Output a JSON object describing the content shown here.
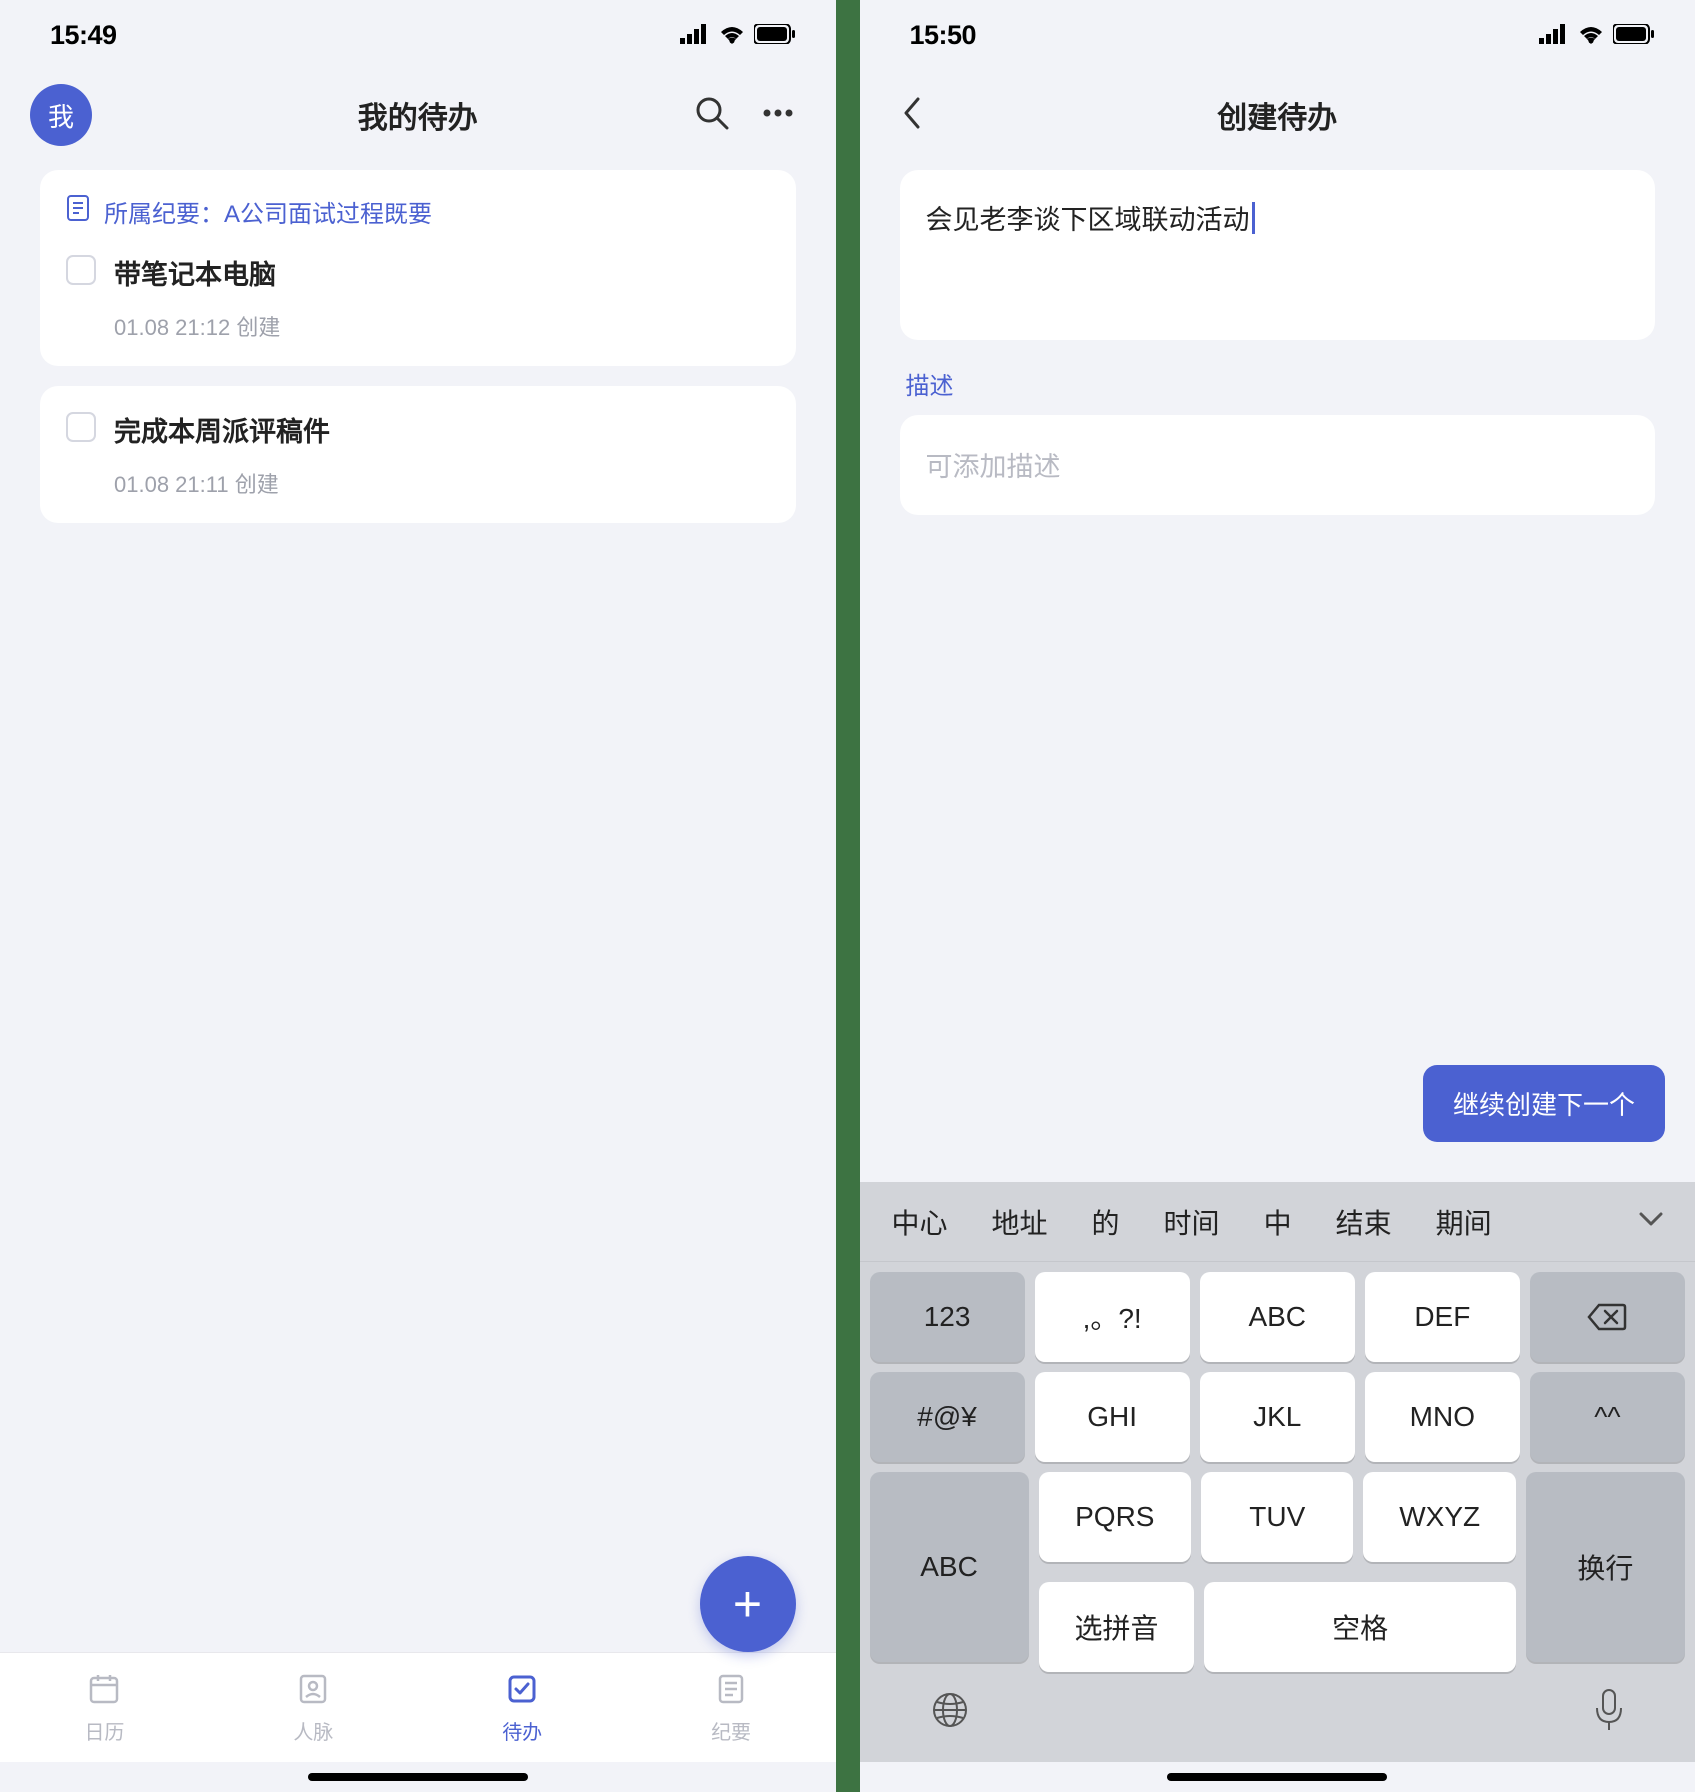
{
  "left": {
    "status_time": "15:49",
    "header": {
      "avatar_text": "我",
      "title": "我的待办"
    },
    "link_prefix": "所属纪要：",
    "link_text": "A公司面试过程既要",
    "todos": [
      {
        "text": "带笔记本电脑",
        "meta": "01.08 21:12 创建"
      },
      {
        "text": "完成本周派评稿件",
        "meta": "01.08 21:11 创建"
      }
    ],
    "nav": {
      "calendar": "日历",
      "contacts": "人脉",
      "todo": "待办",
      "notes": "纪要"
    }
  },
  "right": {
    "status_time": "15:50",
    "header": {
      "title": "创建待办"
    },
    "title_value": "会见老李谈下区域联动活动",
    "desc_label": "描述",
    "desc_placeholder": "可添加描述",
    "continue_label": "继续创建下一个",
    "suggestions": [
      "中心",
      "地址",
      "的",
      "时间",
      "中",
      "结束",
      "期间"
    ],
    "keys": {
      "num": "123",
      "punct": ",。?!",
      "abc1": "ABC",
      "def": "DEF",
      "sym": "#@¥",
      "ghi": "GHI",
      "jkl": "JKL",
      "mno": "MNO",
      "emoji": "^^",
      "abc2": "ABC",
      "pqrs": "PQRS",
      "tuv": "TUV",
      "wxyz": "WXYZ",
      "enter": "换行",
      "pinyin": "选拼音",
      "space": "空格"
    }
  }
}
